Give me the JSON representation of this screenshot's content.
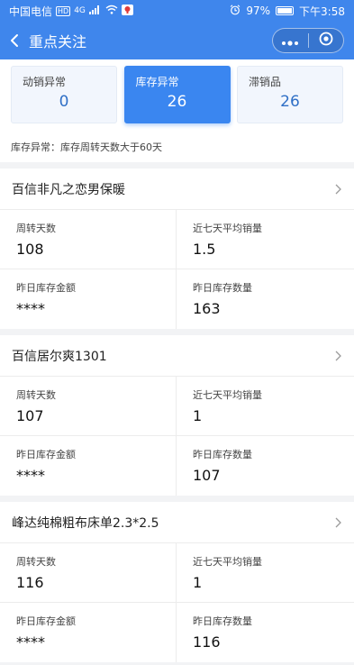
{
  "status_bar": {
    "carrier": "中国电信",
    "hd_badge": "HD",
    "network": "4G",
    "battery_percent": "97%",
    "battery_level": 0.97,
    "time": "下午3:58"
  },
  "nav": {
    "title": "重点关注"
  },
  "summary_cards": [
    {
      "label": "动销异常",
      "value": "0",
      "active": false
    },
    {
      "label": "库存异常",
      "value": "26",
      "active": true
    },
    {
      "label": "滞销品",
      "value": "26",
      "active": false
    }
  ],
  "description": "库存异常：库存周转天数大于60天",
  "products": [
    {
      "name": "百信非凡之恋男保暖",
      "metrics": [
        {
          "label": "周转天数",
          "value": "108"
        },
        {
          "label": "近七天平均销量",
          "value": "1.5"
        },
        {
          "label": "昨日库存金额",
          "value": "****"
        },
        {
          "label": "昨日库存数量",
          "value": "163"
        }
      ]
    },
    {
      "name": "百信居尔爽1301",
      "metrics": [
        {
          "label": "周转天数",
          "value": "107"
        },
        {
          "label": "近七天平均销量",
          "value": "1"
        },
        {
          "label": "昨日库存金额",
          "value": "****"
        },
        {
          "label": "昨日库存数量",
          "value": "107"
        }
      ]
    },
    {
      "name": "峰达纯棉粗布床单2.3*2.5",
      "metrics": [
        {
          "label": "周转天数",
          "value": "116"
        },
        {
          "label": "近七天平均销量",
          "value": "1"
        },
        {
          "label": "昨日库存金额",
          "value": "****"
        },
        {
          "label": "昨日库存数量",
          "value": "116"
        }
      ]
    }
  ],
  "icons": {
    "back": "chevron-left-icon",
    "more": "more-dots-icon",
    "close": "target-circle-icon",
    "row_arrow": "chevron-right-icon"
  },
  "colors": {
    "primary": "#3f86ec",
    "active_card": "#3a86f0",
    "value_blue": "#2f6fc6"
  }
}
